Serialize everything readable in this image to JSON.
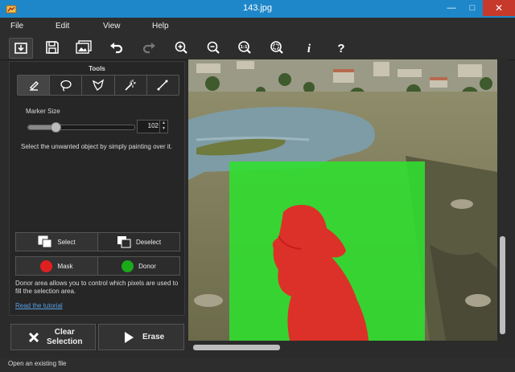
{
  "window": {
    "title": "143.jpg",
    "minimize": "—",
    "maximize": "□",
    "close": "✕"
  },
  "menu": [
    "File",
    "Edit",
    "View",
    "Help"
  ],
  "toolbar": {
    "icons": [
      "open-icon",
      "save-icon",
      "image-icon",
      "undo-icon",
      "redo-icon",
      "zoom-in-icon",
      "zoom-out-icon",
      "actual-size-icon",
      "fit-icon",
      "info-icon",
      "help-icon"
    ]
  },
  "tools": {
    "title": "Tools",
    "items": [
      "marker-tool-icon",
      "lasso-tool-icon",
      "polygon-lasso-tool-icon",
      "magic-wand-tool-icon",
      "line-tool-icon"
    ],
    "selected_index": 0
  },
  "marker": {
    "label": "Marker Size",
    "value": "102",
    "slider_fraction": 0.26
  },
  "hint": "Select the unwanted object by simply painting over it.",
  "selection": {
    "select_label": "Select",
    "deselect_label": "Deselect"
  },
  "mode": {
    "mask_label": "Mask",
    "donor_label": "Donor",
    "mask_color": "#e02020",
    "donor_color": "#1aaa1a"
  },
  "description": "Donor area allows you to control which pixels are used to fill the selection area.",
  "tutorial_link": "Read the tutorial",
  "actions": {
    "clear_label_1": "Clear",
    "clear_label_2": "Selection",
    "erase_label": "Erase"
  },
  "colors": {
    "titlebar": "#1e87c9",
    "donor_overlay": "#2fe02f",
    "mask_overlay": "#e52828"
  },
  "status": "Open an existing file"
}
